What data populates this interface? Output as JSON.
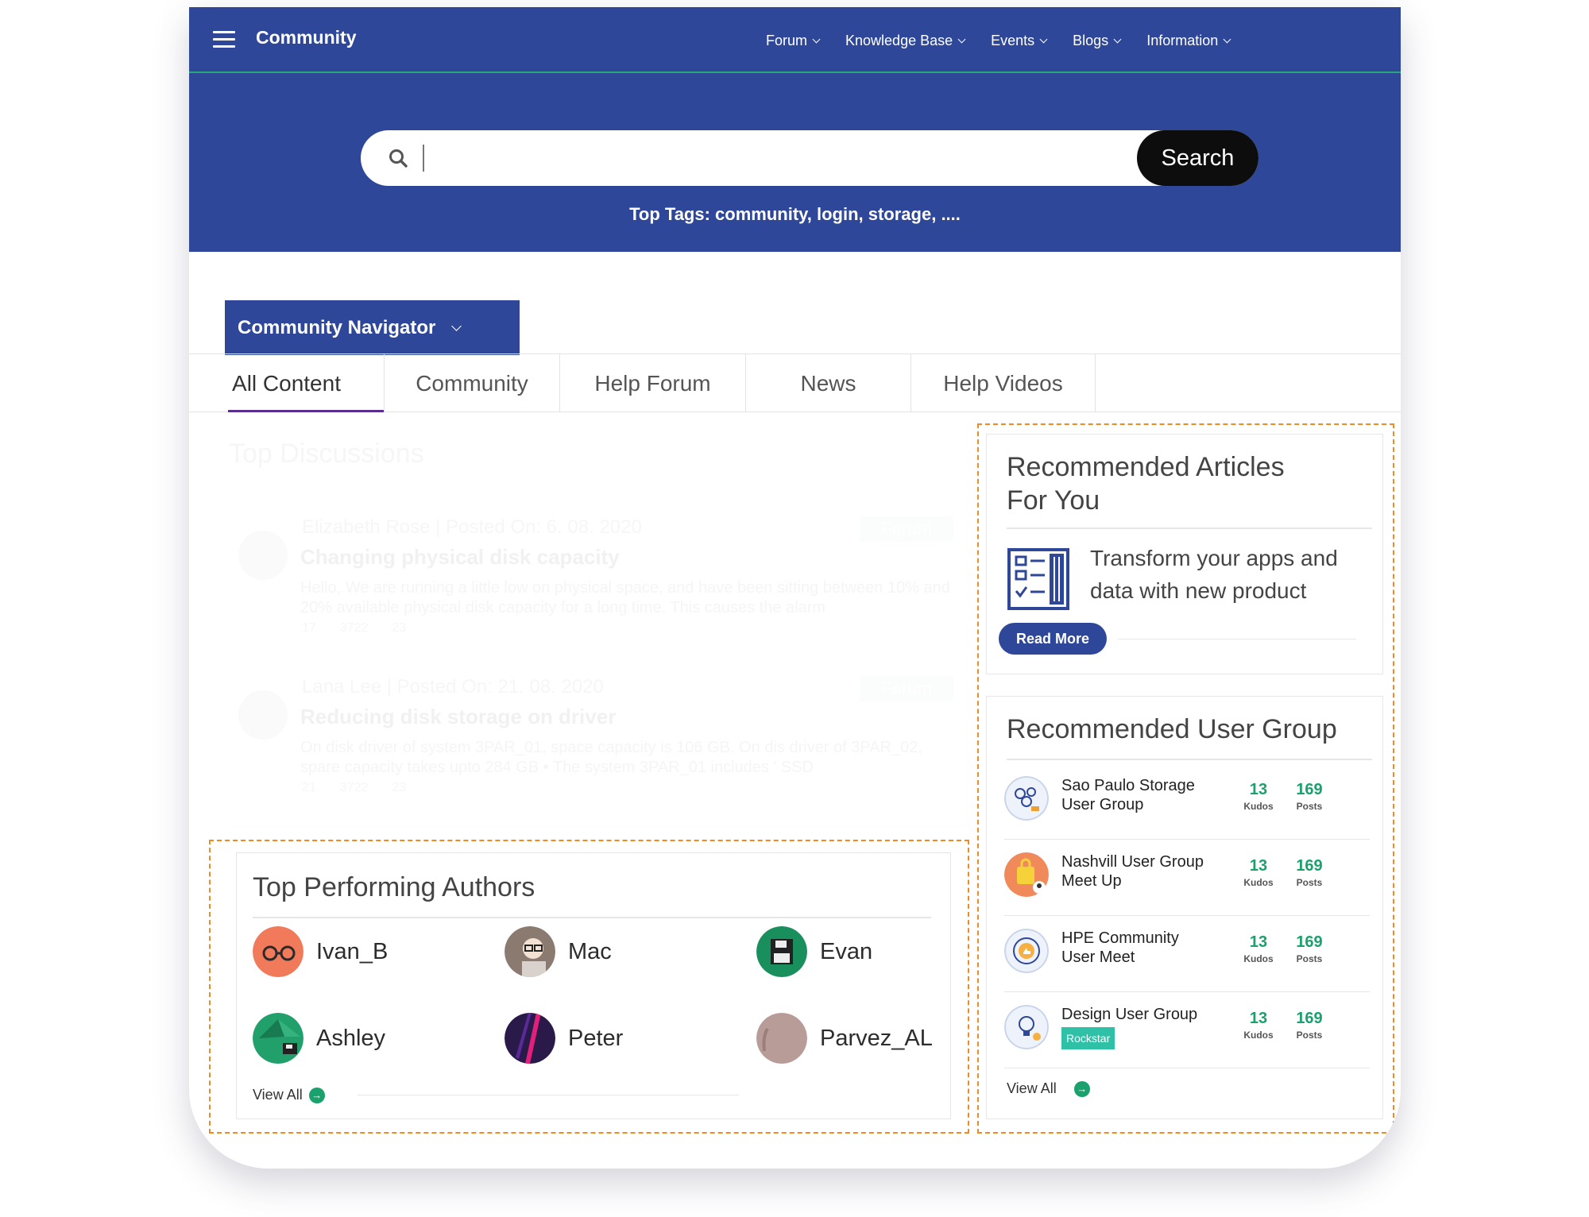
{
  "header": {
    "brand": "Community",
    "menu": [
      "Forum",
      "Knowledge Base",
      "Events",
      "Blogs",
      "Information"
    ]
  },
  "search": {
    "button_label": "Search",
    "top_tags": "Top Tags: community, login, storage, ...."
  },
  "navigator": {
    "label": "Community Navigator"
  },
  "tabs": [
    "All Content",
    "Community",
    "Help Forum",
    "News",
    "Help Videos"
  ],
  "discussions": {
    "title": "Top Discussions",
    "posts": [
      {
        "meta": "Elizabeth Rose | Posted On: 6. 08. 2020",
        "tag": "Forum",
        "title": "Changing physical disk capacity",
        "body": "Hello, We are running a little low on physical space, and have been sitting between 10% and 20% available physical disk capacity for a long time. This causes the alarm",
        "likes": "17",
        "views": "3722",
        "replies": "23"
      },
      {
        "meta": "Lana Lee | Posted On: 21. 08. 2020",
        "tag": "Forum",
        "title": "Reducing disk storage on driver",
        "body": "On disk driver of system 3PAR_01, space capacity is 106 GB. On dis driver of 3PAR_02, spare capacity takes upto 284 GB • The system 3PAR_01 includes ' SSD",
        "likes": "21",
        "views": "3722",
        "replies": "23"
      }
    ]
  },
  "authors": {
    "title": "Top Performing Authors",
    "list": [
      "Ivan_B",
      "Mac",
      "Evan",
      "Ashley",
      "Peter",
      "Parvez_AL"
    ],
    "view_all": "View All"
  },
  "articles": {
    "title_line1": "Recommended Articles",
    "title_line2": "For You",
    "text_line1": "Transform your apps and",
    "text_line2": "data with new product",
    "read_more": "Read More"
  },
  "groups": {
    "title": "Recommended User Group",
    "list": [
      {
        "name_line1": "Sao Paulo Storage",
        "name_line2": "User Group",
        "kudos": "13",
        "kudos_label": "Kudos",
        "posts": "169",
        "posts_label": "Posts"
      },
      {
        "name_line1": "Nashvill User Group",
        "name_line2": "Meet Up",
        "kudos": "13",
        "kudos_label": "Kudos",
        "posts": "169",
        "posts_label": "Posts"
      },
      {
        "name_line1": "HPE Community",
        "name_line2": "User Meet",
        "kudos": "13",
        "kudos_label": "Kudos",
        "posts": "169",
        "posts_label": "Posts"
      },
      {
        "name_line1": "Design User Group",
        "badge": "Rockstar",
        "kudos": "13",
        "kudos_label": "Kudos",
        "posts": "169",
        "posts_label": "Posts"
      }
    ],
    "view_all": "View All"
  },
  "colors": {
    "primary": "#2e4799",
    "accent_green": "#1aa16d",
    "highlight": "#f08a24"
  }
}
